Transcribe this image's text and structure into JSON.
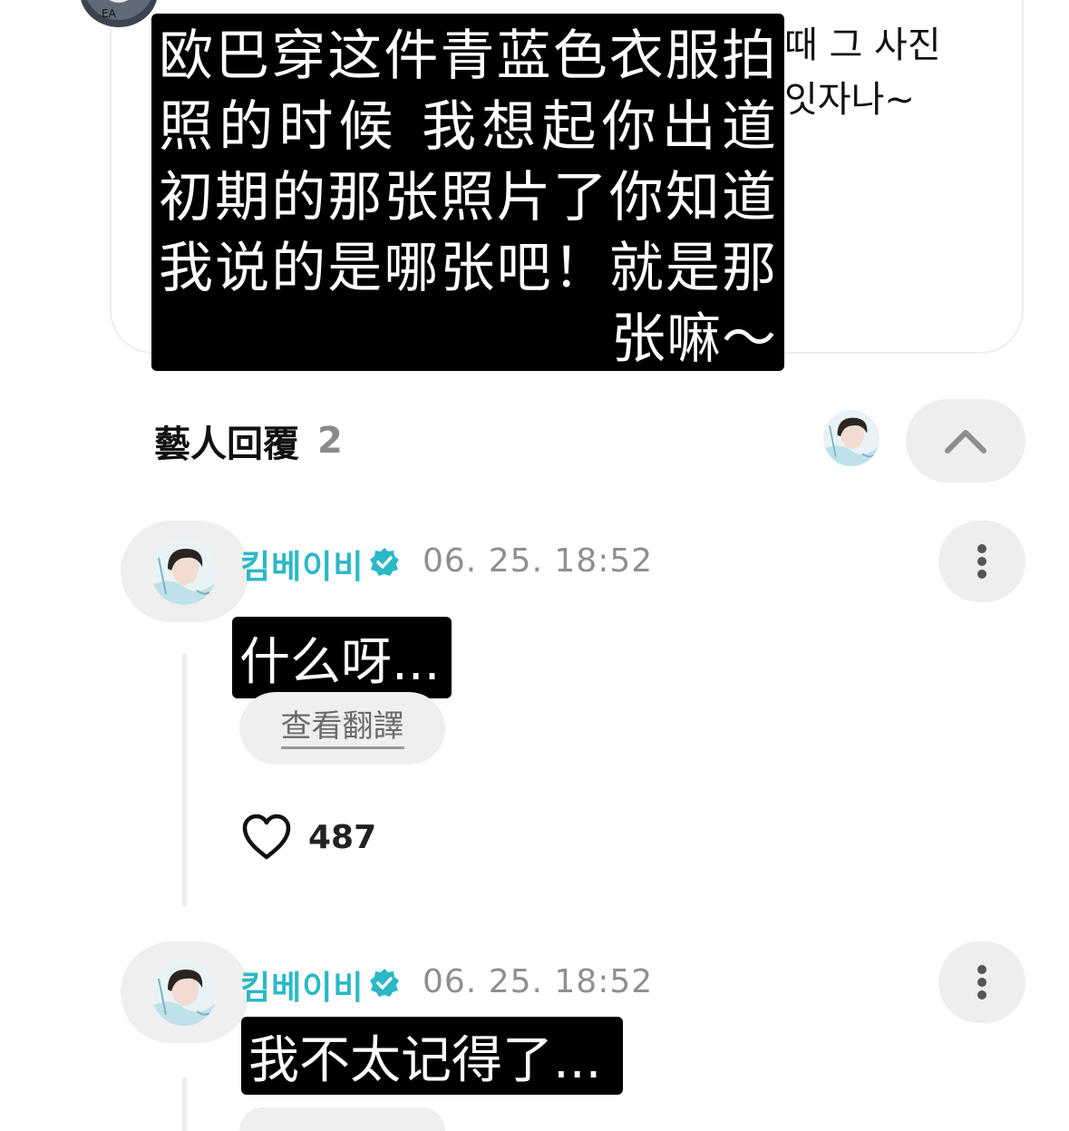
{
  "post": {
    "overlay_text": "欧巴穿这件青蓝色衣服拍照的时候 我想起你出道初期的那张照片了你知道我说的是哪张吧！就是那张嘛～",
    "korean_text": "때 그 사진\n잇자나~",
    "poster_avatar_tag": "EA"
  },
  "replies_section": {
    "title": "藝人回覆",
    "count": "2",
    "collapse_icon": "chevron-up-icon"
  },
  "replies": [
    {
      "author": "킴베이비",
      "timestamp": "06. 25. 18:52",
      "text": "什么呀...",
      "translate_label": "查看翻譯",
      "likes": "487"
    },
    {
      "author": "킴베이비",
      "timestamp": "06. 25. 18:52",
      "text": "我不太记得了..."
    }
  ],
  "colors": {
    "accent": "#2bb8c7",
    "muted": "#8f8f8f",
    "chip_bg": "#eeeeee"
  }
}
